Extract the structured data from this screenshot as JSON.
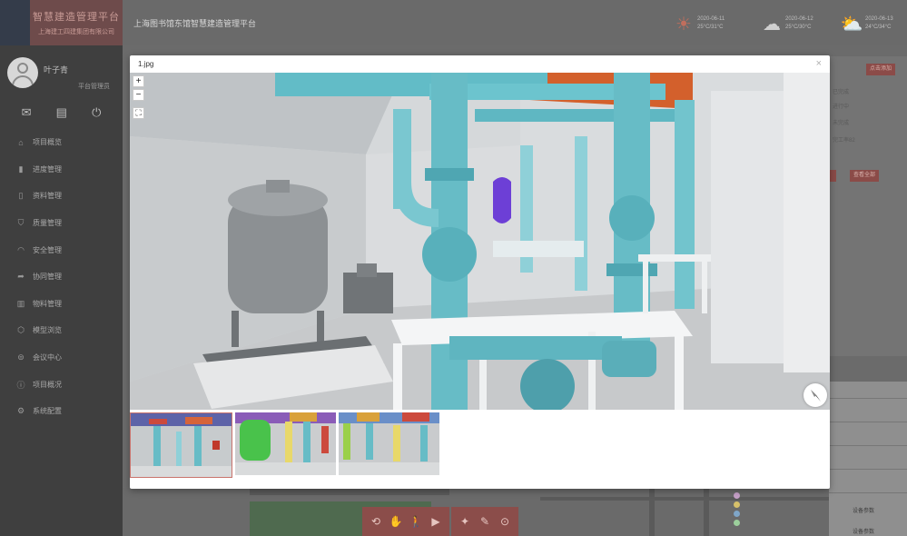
{
  "sidebar": {
    "logo_title": "智慧建造管理平台",
    "logo_sub": "上海建工四建集团有限公司",
    "user_name": "叶子青",
    "user_role": "平台管理员",
    "quick_icons": [
      "mail-icon",
      "id-card-icon",
      "power-icon"
    ],
    "nav": [
      {
        "icon": "home-icon",
        "label": "项目概览"
      },
      {
        "icon": "chart-icon",
        "label": "进度管理"
      },
      {
        "icon": "doc-icon",
        "label": "资料管理"
      },
      {
        "icon": "shield-icon",
        "label": "质量管理"
      },
      {
        "icon": "helmet-icon",
        "label": "安全管理"
      },
      {
        "icon": "share-icon",
        "label": "协同管理"
      },
      {
        "icon": "book-icon",
        "label": "物料管理"
      },
      {
        "icon": "cube-icon",
        "label": "模型浏览"
      },
      {
        "icon": "lock-icon",
        "label": "会议中心"
      },
      {
        "icon": "info-icon",
        "label": "项目概况"
      },
      {
        "icon": "settings-icon",
        "label": "系统配置"
      }
    ]
  },
  "header": {
    "page_title": "上海图书馆东馆智慧建造管理平台",
    "weather": [
      {
        "icon": "sun-cloud-icon",
        "date": "2020-06-11",
        "temp": "25°C/31°C"
      },
      {
        "icon": "rain-cloud-icon",
        "date": "2020-06-12",
        "temp": "25°C/30°C"
      },
      {
        "icon": "sun-cloud-icon",
        "date": "2020-06-13",
        "temp": "24°C/34°C"
      }
    ]
  },
  "right_panel": {
    "top_button": "点击添加",
    "lines": [
      "已完成",
      "进行中",
      "未完成",
      "完工率82"
    ],
    "bottom_button": "查看全部",
    "lower_rows": [
      "设备参数",
      "设备参数"
    ]
  },
  "toolbar": {
    "groups": [
      [
        "orbit-icon",
        "pan-icon",
        "person-icon",
        "camera-icon"
      ],
      [
        "walk-icon",
        "measure-icon",
        "section-icon"
      ]
    ]
  },
  "legend_colors": [
    "#c6a0c8",
    "#d6c06a",
    "#7fa6c8",
    "#9ccf9c"
  ],
  "modal": {
    "title": "1.jpg",
    "close": "×",
    "zoom_in": "+",
    "zoom_out": "−",
    "fullscreen": "⛶",
    "thumbnails": [
      "thumbnail-1",
      "thumbnail-2",
      "thumbnail-3"
    ]
  }
}
